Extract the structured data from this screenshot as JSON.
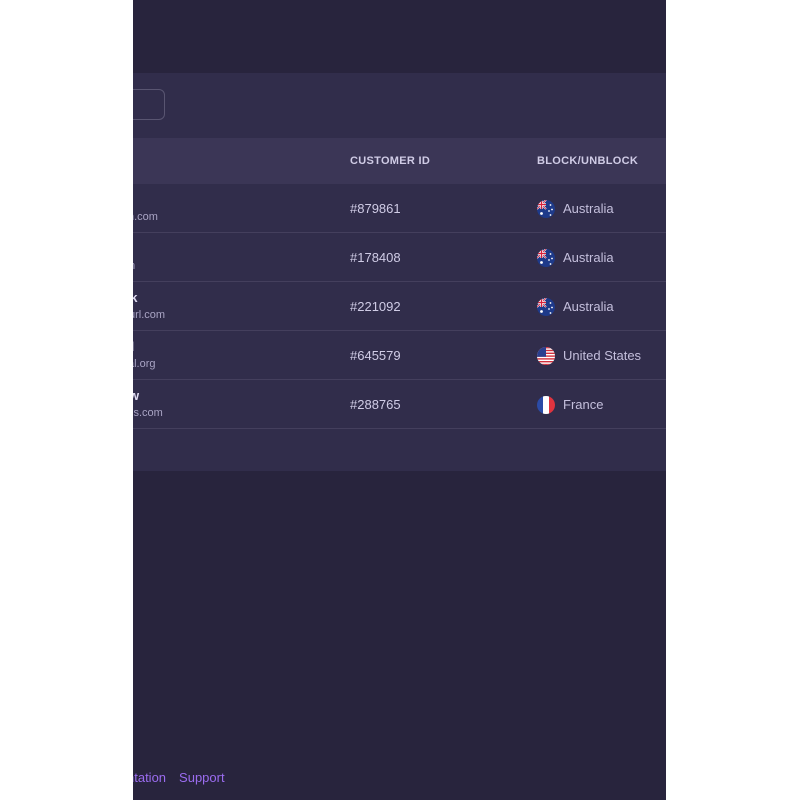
{
  "table": {
    "columns": {
      "customer_id": "CUSTOMER ID",
      "block_unblock": "BLOCK/UNBLOCK"
    },
    "rows": [
      {
        "name_visible": "er",
        "email_visible": "n.com",
        "customer_id": "#879861",
        "country": "Australia",
        "flag_icon": "australia-flag-icon"
      },
      {
        "name_visible": "",
        "email_visible": "m",
        "customer_id": "#178408",
        "country": "Australia",
        "flag_icon": "australia-flag-icon"
      },
      {
        "name_visible": "ck",
        "email_visible": "url.com",
        "customer_id": "#221092",
        "country": "Australia",
        "flag_icon": "australia-flag-icon"
      },
      {
        "name_visible": "ll",
        "email_visible": "al.org",
        "customer_id": "#645579",
        "country": "United States",
        "flag_icon": "united-states-flag-icon"
      },
      {
        "name_visible": "w",
        "email_visible": "is.com",
        "customer_id": "#288765",
        "country": "France",
        "flag_icon": "france-flag-icon"
      }
    ]
  },
  "footer": {
    "documentation_visible": "ntation",
    "support": "Support"
  },
  "colors": {
    "background": "#28243d",
    "panel": "#312d4b",
    "header_row": "#3b3656",
    "link": "#9b6cf0"
  }
}
